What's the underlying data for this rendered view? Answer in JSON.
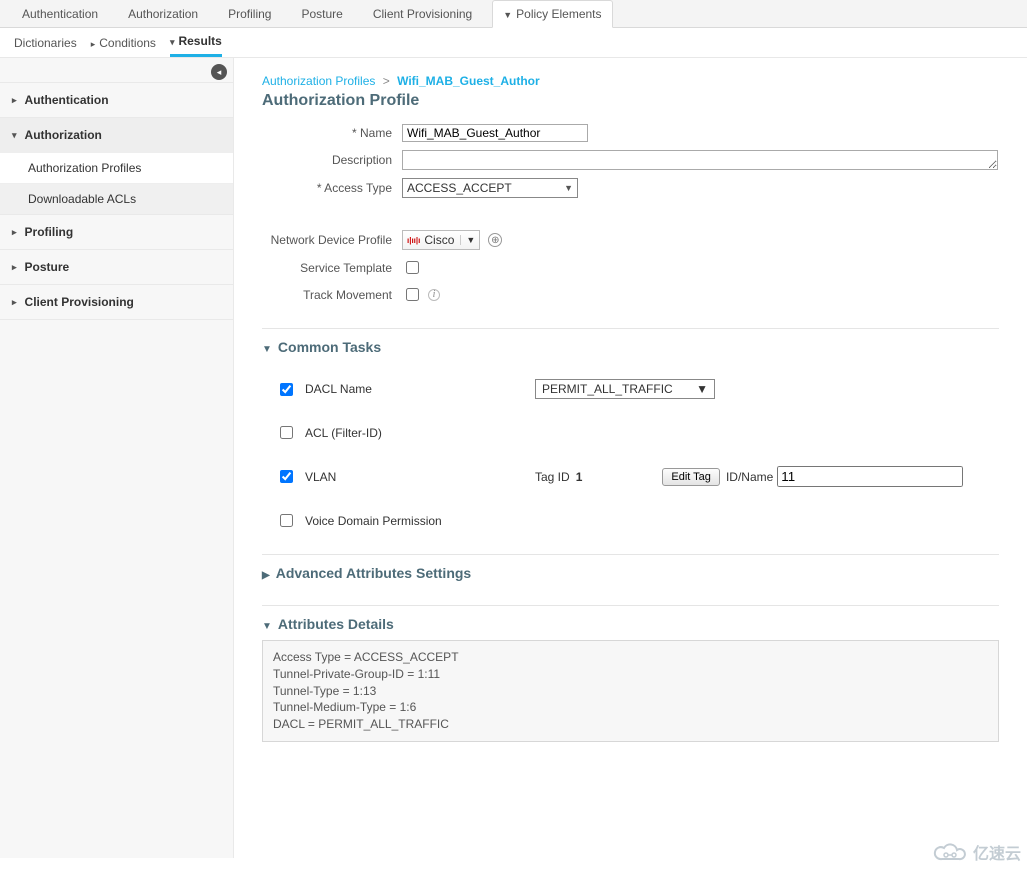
{
  "topTabs": {
    "authentication": "Authentication",
    "authorization": "Authorization",
    "profiling": "Profiling",
    "posture": "Posture",
    "clientProvisioning": "Client Provisioning",
    "policyElements": "Policy Elements"
  },
  "subTabs": {
    "dictionaries": "Dictionaries",
    "conditions": "Conditions",
    "results": "Results"
  },
  "sidebar": {
    "authentication": "Authentication",
    "authorization": "Authorization",
    "authProfiles": "Authorization Profiles",
    "dACLs": "Downloadable ACLs",
    "profiling": "Profiling",
    "posture": "Posture",
    "clientProvisioning": "Client Provisioning"
  },
  "breadcrumb": {
    "root": "Authorization Profiles",
    "current": "Wifi_MAB_Guest_Author"
  },
  "pageTitle": "Authorization Profile",
  "form": {
    "nameLabel": "* Name",
    "nameValue": "Wifi_MAB_Guest_Author",
    "descLabel": "Description",
    "descValue": "",
    "accessTypeLabel": "* Access Type",
    "accessTypeValue": "ACCESS_ACCEPT",
    "netDeviceLabel": "Network Device Profile",
    "netDeviceValue": "Cisco",
    "serviceTemplateLabel": "Service Template",
    "trackMovementLabel": "Track Movement"
  },
  "sections": {
    "commonTasks": "Common Tasks",
    "advanced": "Advanced Attributes Settings",
    "attribDetails": "Attributes Details"
  },
  "tasks": {
    "dacl": {
      "label": "DACL Name",
      "value": "PERMIT_ALL_TRAFFIC",
      "checked": true
    },
    "acl": {
      "label": "ACL (Filter-ID)",
      "checked": false
    },
    "vlan": {
      "label": "VLAN",
      "checked": true,
      "tagIdLabel": "Tag ID",
      "tagId": "1",
      "editTag": "Edit Tag",
      "idNameLabel": "ID/Name",
      "idName": "11"
    },
    "voice": {
      "label": "Voice Domain Permission",
      "checked": false
    }
  },
  "attribDetails": {
    "l1": "Access Type = ACCESS_ACCEPT",
    "l2": "Tunnel-Private-Group-ID = 1:11",
    "l3": "Tunnel-Type = 1:13",
    "l4": "Tunnel-Medium-Type = 1:6",
    "l5": "DACL = PERMIT_ALL_TRAFFIC"
  },
  "watermark": "亿速云"
}
